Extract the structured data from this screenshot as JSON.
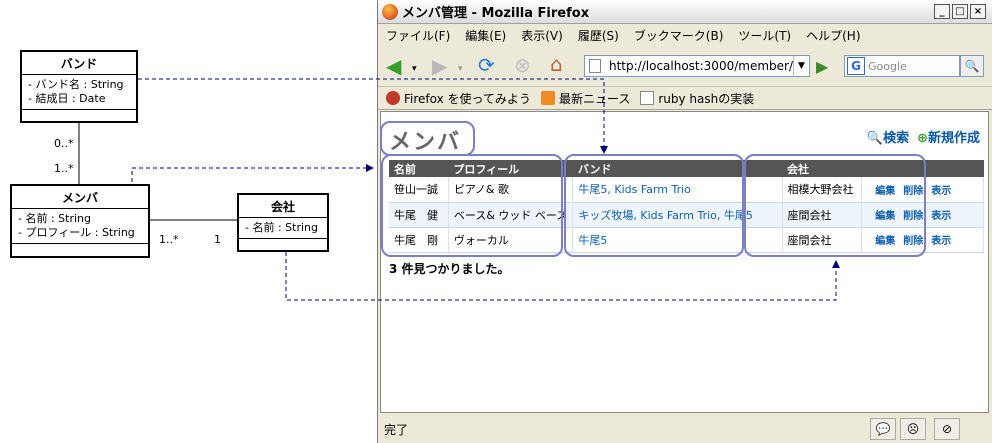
{
  "uml": {
    "band": {
      "name": "バンド",
      "attrs": [
        "- バンド名 : String",
        "- 結成日 : Date"
      ]
    },
    "member": {
      "name": "メンバ",
      "attrs": [
        "- 名前 : String",
        "- プロフィール : String"
      ]
    },
    "company": {
      "name": "会社",
      "attrs": [
        "- 名前 : String"
      ]
    },
    "mult_band_member_top": "0..*",
    "mult_band_member_bottom": "1..*",
    "mult_member_company_left": "1..*",
    "mult_member_company_right": "1"
  },
  "browser": {
    "title": "メンバ管理 - Mozilla Firefox",
    "menu": [
      "ファイル(F)",
      "編集(E)",
      "表示(V)",
      "履歴(S)",
      "ブックマーク(B)",
      "ツール(T)",
      "ヘルプ(H)"
    ],
    "url": "http://localhost:3000/member/",
    "search_placeholder": "Google",
    "bookmarks": [
      "Firefox を使ってみよう",
      "最新ニュース",
      "ruby hashの実装"
    ],
    "status": "完了"
  },
  "page": {
    "title": "メンバ",
    "search_link": "検索",
    "new_link": "新規作成",
    "columns": [
      "名前",
      "プロフィール",
      "バンド",
      "会社"
    ],
    "rows": [
      {
        "name": "笹山一誠",
        "profile": "ピアノ& 歌",
        "band": "牛尾5, Kids Farm Trio",
        "company": "相模大野会社"
      },
      {
        "name": "牛尾　健",
        "profile": "ベース& ウッド ベース",
        "band": "キッズ牧場, Kids Farm Trio, 牛尾5",
        "company": "座間会社"
      },
      {
        "name": "牛尾　剛",
        "profile": "ヴォーカル",
        "band": "牛尾5",
        "company": "座間会社"
      }
    ],
    "ops": {
      "edit": "編集",
      "delete": "削除",
      "show": "表示"
    },
    "found": "3 件見つかりました。"
  },
  "colors": {
    "highlight": "#7b7fc4",
    "arrow": "#000080",
    "link": "#1060b0"
  }
}
